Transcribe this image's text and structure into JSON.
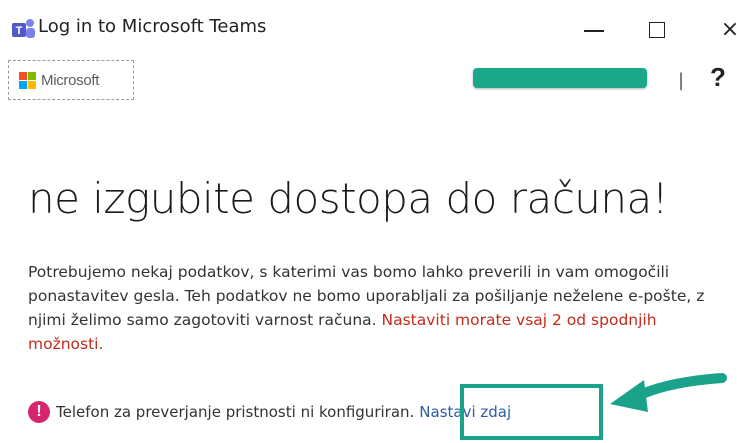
{
  "window": {
    "title": "Log in to Microsoft Teams",
    "icon": "teams-icon",
    "controls": {
      "minimize_icon": "minimize-icon",
      "maximize_icon": "maximize-icon",
      "close_icon": "close-icon",
      "close_glyph": "×"
    }
  },
  "header": {
    "brand_label": "Microsoft",
    "separator": "|",
    "help_label": "?"
  },
  "main": {
    "heading": "ne izgubite dostopa do računa!",
    "body_normal": "Potrebujemo nekaj podatkov, s katerimi vas bomo lahko preverili in vam omogočili ponastavitev gesla. Teh podatkov ne bomo uporabljali za pošiljanje neželene e-pošte, z njimi želimo samo zagotoviti varnost računa.",
    "body_warning": "Nastaviti morate vsaj 2 od spodnjih možnosti.",
    "status_icon_glyph": "!",
    "status_text": "Telefon za preverjanje pristnosti ni konfiguriran.",
    "setup_link": "Nastavi zdaj"
  },
  "colors": {
    "accent_green": "#1aa889",
    "annotation_green": "#1aa38a",
    "warning_red": "#c42b1c",
    "alert_magenta": "#d6246e",
    "link_blue": "#2b5ca8",
    "ms_red": "#f25022",
    "ms_green": "#7fba00",
    "ms_blue": "#00a4ef",
    "ms_yellow": "#ffb900"
  }
}
